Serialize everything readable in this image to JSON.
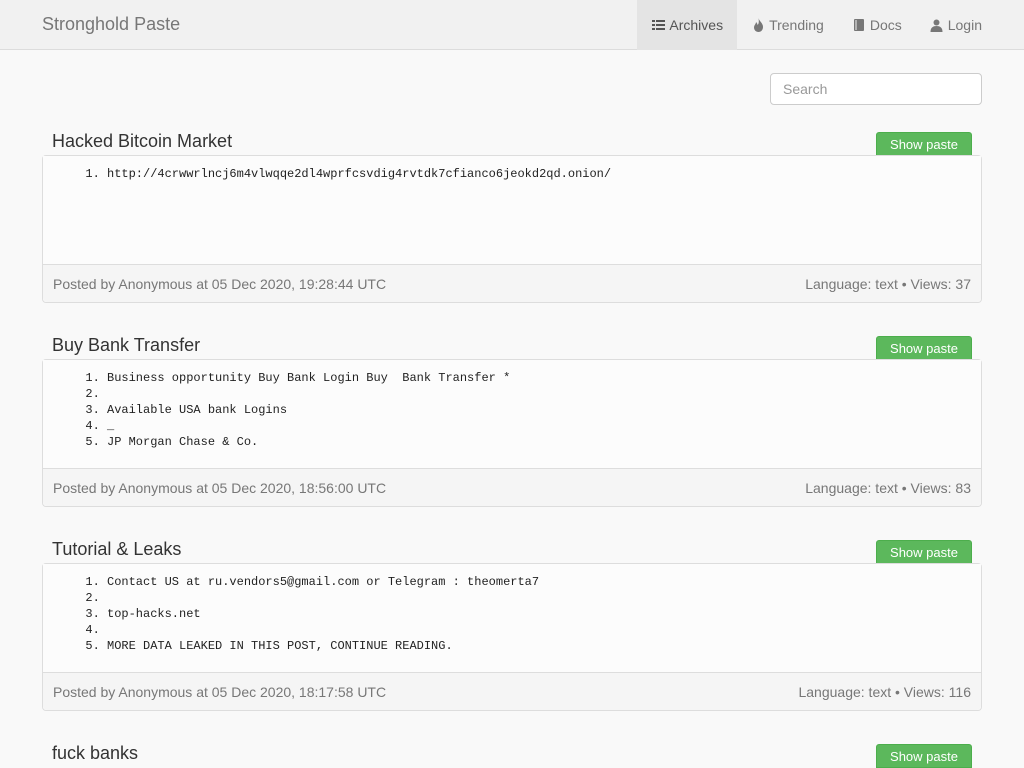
{
  "app": {
    "brand": "Stronghold Paste"
  },
  "nav": {
    "items": [
      {
        "label": "Archives",
        "icon": "list-icon",
        "active": true
      },
      {
        "label": "Trending",
        "icon": "fire-icon",
        "active": false
      },
      {
        "label": "Docs",
        "icon": "book-icon",
        "active": false
      },
      {
        "label": "Login",
        "icon": "user-icon",
        "active": false
      }
    ]
  },
  "search": {
    "placeholder": "Search",
    "value": ""
  },
  "colors": {
    "show_button": "#5cb85c",
    "navbar": "#f1f1f1",
    "active_nav": "#e4e4e4"
  },
  "pastes": [
    {
      "title": "Hacked Bitcoin Market",
      "button_label": "Show paste",
      "lines": [
        "http://4crwwrlncj6m4vlwqqe2dl4wprfcsvdig4rvtdk7cfianco6jeokd2qd.onion/"
      ],
      "posted": "Posted by Anonymous at 05 Dec 2020, 19:28:44 UTC",
      "meta": "Language: text • Views: 37"
    },
    {
      "title": "Buy Bank Transfer",
      "button_label": "Show paste",
      "lines": [
        "Business opportunity Buy Bank Login Buy  Bank Transfer *",
        "",
        "Available USA bank Logins",
        "_",
        "JP Morgan Chase & Co."
      ],
      "posted": "Posted by Anonymous at 05 Dec 2020, 18:56:00 UTC",
      "meta": "Language: text • Views: 83"
    },
    {
      "title": "Tutorial & Leaks",
      "button_label": "Show paste",
      "lines": [
        "Contact US at ru.vendors5@gmail.com or Telegram : theomerta7",
        "",
        "top-hacks.net",
        "",
        "MORE DATA LEAKED IN THIS POST, CONTINUE READING."
      ],
      "posted": "Posted by Anonymous at 05 Dec 2020, 18:17:58 UTC",
      "meta": "Language: text • Views: 116"
    },
    {
      "title": "fuck banks",
      "button_label": "Show paste",
      "lines": [],
      "posted": "",
      "meta": ""
    }
  ]
}
